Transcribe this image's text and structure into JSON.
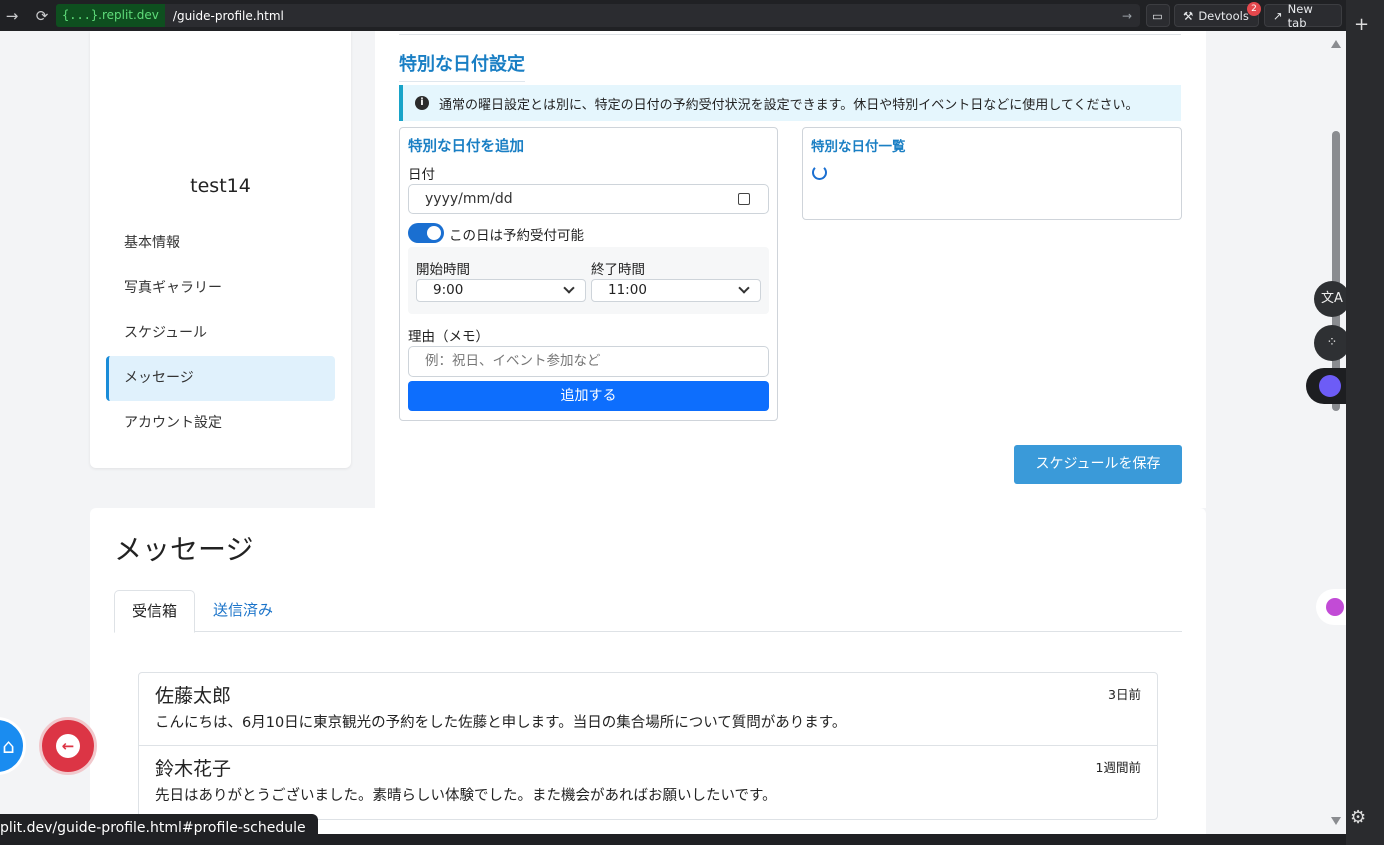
{
  "browser": {
    "host_prefix": "{...}",
    "host_domain": ".replit.dev",
    "path": "/guide-profile.html",
    "devtools_label": "Devtools",
    "devtools_badge": "2",
    "newtab_label": "New tab",
    "status_url": "plit.dev/guide-profile.html#profile-schedule"
  },
  "sidebar": {
    "username": "test14",
    "items": [
      {
        "label": "基本情報"
      },
      {
        "label": "写真ギャラリー"
      },
      {
        "label": "スケジュール"
      },
      {
        "label": "メッセージ"
      },
      {
        "label": "アカウント設定"
      }
    ],
    "active_index": 3
  },
  "schedule": {
    "section_title": "特別な日付設定",
    "info_text": "通常の曜日設定とは別に、特定の日付の予約受付状況を設定できます。休日や特別イベント日などに使用してください。",
    "add_box_title": "特別な日付を追加",
    "date_label": "日付",
    "date_placeholder": "yyyy/mm/dd",
    "toggle_label": "この日は予約受付可能",
    "toggle_on": true,
    "start_label": "開始時間",
    "start_value": "9:00",
    "end_label": "終了時間",
    "end_value": "11:00",
    "memo_label": "理由（メモ）",
    "memo_placeholder": "例：祝日、イベント参加など",
    "add_button": "追加する",
    "list_title": "特別な日付一覧",
    "save_button": "スケジュールを保存"
  },
  "messages": {
    "title": "メッセージ",
    "tabs": [
      {
        "label": "受信箱"
      },
      {
        "label": "送信済み"
      }
    ],
    "items": [
      {
        "name": "佐藤太郎",
        "time": "3日前",
        "text": "こんにちは、6月10日に東京観光の予約をした佐藤と申します。当日の集合場所について質問があります。"
      },
      {
        "name": "鈴木花子",
        "time": "1週間前",
        "text": "先日はありがとうございました。素晴らしい体験でした。また機会があればお願いしたいです。"
      }
    ]
  },
  "colors": {
    "accent": "#1a7fc4",
    "primary_button": "#0d6efd",
    "save_button": "#3a9ad9",
    "home_fab": "#1a8cf0",
    "back_fab": "#dc3545"
  }
}
